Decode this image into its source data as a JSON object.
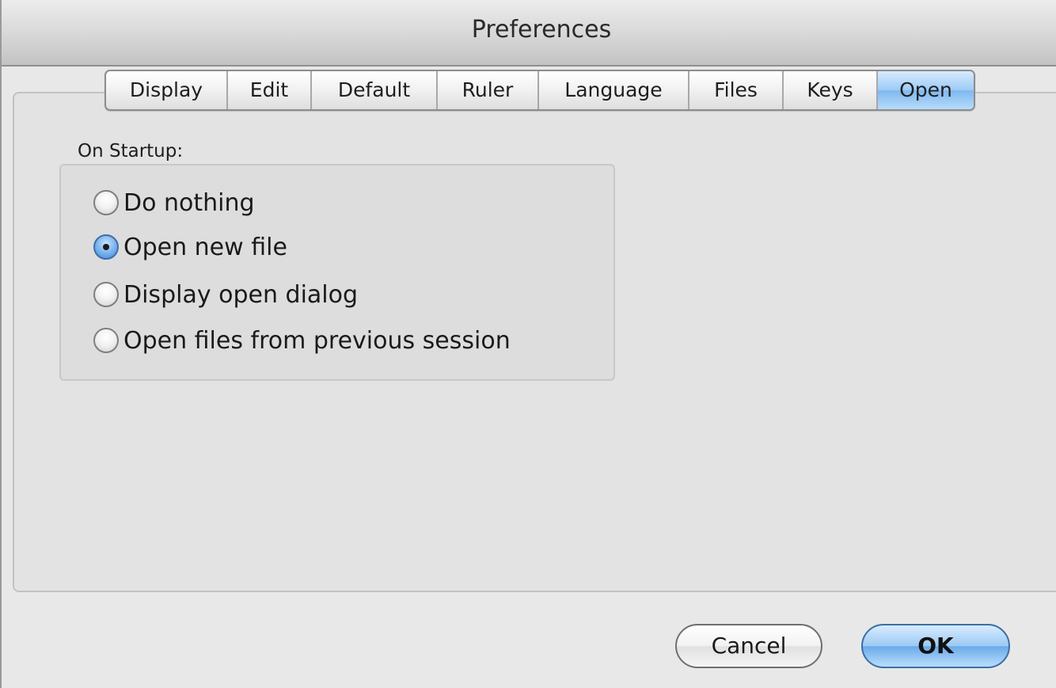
{
  "window": {
    "title": "Preferences"
  },
  "tabs": [
    {
      "label": "Display",
      "selected": false
    },
    {
      "label": "Edit",
      "selected": false
    },
    {
      "label": "Default",
      "selected": false
    },
    {
      "label": "Ruler",
      "selected": false
    },
    {
      "label": "Language",
      "selected": false
    },
    {
      "label": "Files",
      "selected": false
    },
    {
      "label": "Keys",
      "selected": false
    },
    {
      "label": "Open",
      "selected": true
    }
  ],
  "startup": {
    "label": "On Startup:",
    "selected_option": "Open new file",
    "options": [
      {
        "label": "Do nothing",
        "checked": false
      },
      {
        "label": "Open new file",
        "checked": true
      },
      {
        "label": "Display open dialog",
        "checked": false
      },
      {
        "label": "Open files from previous session",
        "checked": false
      }
    ]
  },
  "buttons": {
    "cancel_label": "Cancel",
    "ok_label": "OK"
  },
  "colors": {
    "selected_tab": "#9ccaf6",
    "default_button": "#6aaaea",
    "window_background": "#e8e8e8"
  }
}
